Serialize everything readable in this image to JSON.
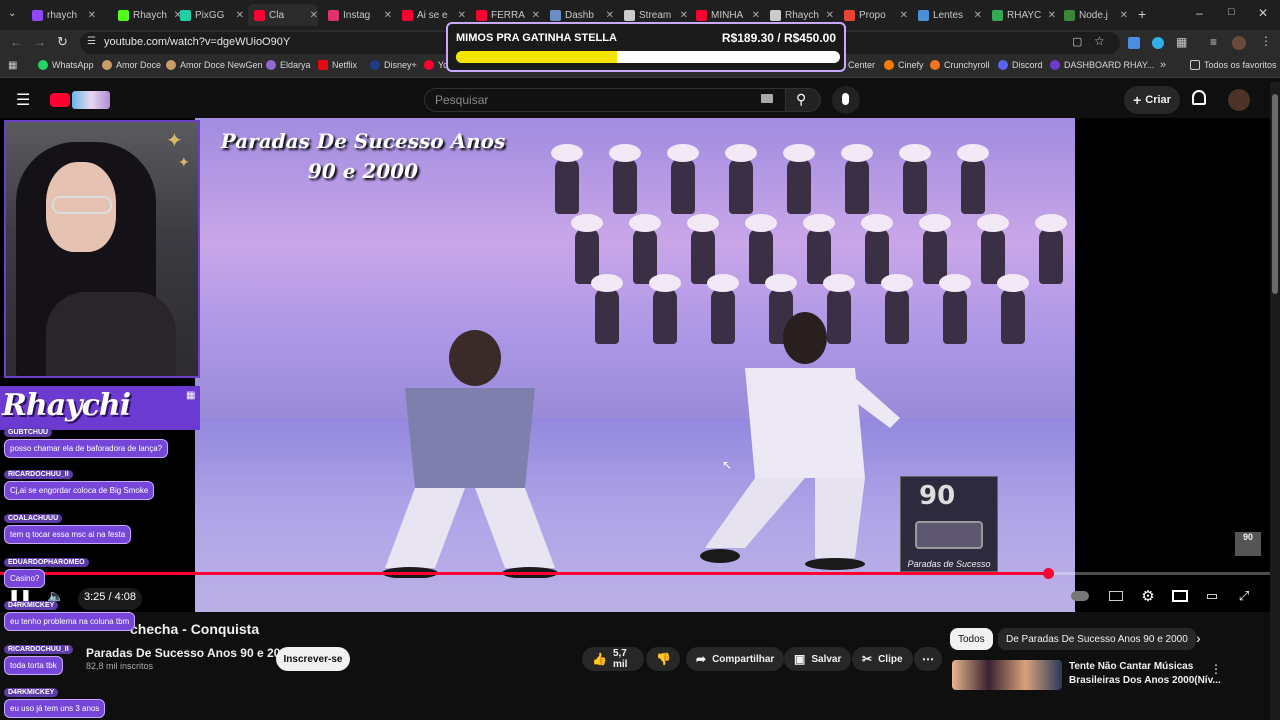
{
  "browser": {
    "tabs": [
      {
        "label": "rhaych",
        "color": "#9146ff"
      },
      {
        "label": "Rhaych",
        "color": "#53fc18"
      },
      {
        "label": "PixGG",
        "color": "#1ed0a6"
      },
      {
        "label": "Cla",
        "color": "#ff0033"
      },
      {
        "label": "Instag",
        "color": "#e1306c"
      },
      {
        "label": "Ai se e",
        "color": "#ff0033"
      },
      {
        "label": "FERRA",
        "color": "#ff0033"
      },
      {
        "label": "Dashb",
        "color": "#6a8ec7"
      },
      {
        "label": "Stream",
        "color": "#cccccc"
      },
      {
        "label": "MINHA",
        "color": "#ff0033"
      },
      {
        "label": "Rhaych",
        "color": "#cccccc"
      },
      {
        "label": "Propo",
        "color": "#ea4335"
      },
      {
        "label": "Lentes",
        "color": "#4a90d9"
      },
      {
        "label": "RHAYC",
        "color": "#34a853"
      },
      {
        "label": "Node.j",
        "color": "#3c873a"
      }
    ],
    "url": "youtube.com/watch?v=dgeWUioO90Y",
    "bookmarks": [
      "WhatsApp",
      "Amor Doce",
      "Amor Doce NewGen",
      "Eldarya",
      "Netflix",
      "Disney+",
      "Yo",
      "Center",
      "Cinefy",
      "Crunchyroll",
      "Discord",
      "DASHBOARD RHAY...",
      "Todos os favoritos"
    ]
  },
  "goal": {
    "title": "MIMOS PRA GATINHA STELLA",
    "amount": "R$189.30 / R$450.00",
    "fraction": 0.42
  },
  "youtube": {
    "search_placeholder": "Pesquisar",
    "create_label": "Criar"
  },
  "video": {
    "overlay_title": "Paradas De Sucesso Anos 90 e 2000",
    "logo_big": "90",
    "logo_caption": "Paradas de Sucesso",
    "mini_logo": "90",
    "time": "3:25 / 4:08",
    "progress": 0.825
  },
  "info": {
    "title": "checha - Conquista",
    "channel": "Paradas De Sucesso Anos 90 e 2000",
    "subscribers": "82,8 mil inscritos",
    "subscribe": "Inscrever-se",
    "likes": "5,7 mil",
    "share": "Compartilhar",
    "save": "Salvar",
    "clip": "Clipe"
  },
  "side": {
    "chip_all": "Todos",
    "chip_channel": "De Paradas De Sucesso Anos 90 e 2000",
    "rec_title_1": "Tente Não Cantar Músicas",
    "rec_title_2": "Brasileiras Dos Anos 2000(Nív..."
  },
  "stream": {
    "brand": "Rhaychi",
    "chat": [
      {
        "user": "GUBTCHUU",
        "message": "posso chamar ela de baforadora de lança?"
      },
      {
        "user": "RICARDOCHUU_II",
        "message": "Cj,ai se engordar coloca de Big Smoke"
      },
      {
        "user": "COALACHUUU",
        "message": "tem q tocar essa msc ai na festa"
      },
      {
        "user": "EDUARDOPHAROMEO",
        "message": "Casino?"
      },
      {
        "user": "D4RKMICKEY",
        "message": "eu tenho problema na coluna tbm"
      },
      {
        "user": "RICARDOCHUU_II",
        "message": "toda torta tbk"
      },
      {
        "user": "D4RKMICKEY",
        "message": "eu uso já tem uns 3 anos"
      }
    ]
  }
}
